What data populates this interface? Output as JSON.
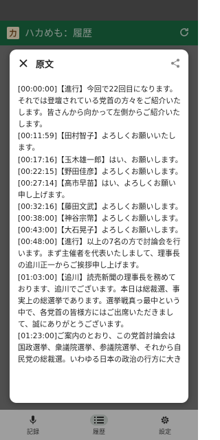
{
  "app": {
    "title": "ハカめも：履歴",
    "logo_text": "力"
  },
  "dialog": {
    "title": "原文",
    "transcript": [
      "[00:00:00]【進行】今回で22回目になります。それでは登壇されている党首の方々をご紹介いたします。皆さんから向かって左側からご紹介いたします。",
      "[00:11:59]【田村智子】よろしくお願いいたします。",
      "[00:17:16]【玉木雄一郎】はい、お願いします。",
      "[00:22:15]【野田佳彦】よろしくお願いします。",
      "[00:27:14]【高市早苗】はい、よろしくお願い申し上げます。",
      "[00:32:16]【藤田文武】よろしくお願いします。",
      "[00:38:00]【神谷宗幣】よろしくお願いします。",
      "[00:43:00]【大石晃子】よろしくお願いします。",
      "[00:48:00]【進行】以上の7名の方で討論会を行います。まず主催者を代表いたしまして、理事長の追川正一からご挨拶申し上げます。",
      "[01:03:00]【追川】読売新聞の理事長を務めております、追川でございます。本日は総裁選、事実上の総選挙であります。選挙戦真っ最中という中で、各党首の皆様方にはご出席いただきまして、誠にありがとうございます。",
      "[01:23:00]ご案内のとおり、この党首討論会は国政選挙、衆議院選挙、参議院選挙、それから自民党の総裁選。いわゆる日本の政治の行方に大き"
    ]
  },
  "nav": {
    "items": [
      {
        "label": "記録",
        "icon": "microphone-icon"
      },
      {
        "label": "履歴",
        "icon": "list-icon"
      },
      {
        "label": "設定",
        "icon": "gear-icon"
      }
    ]
  },
  "colors": {
    "app_bar": "#1b6d44",
    "scrim": "rgba(0,0,0,0.35)"
  }
}
